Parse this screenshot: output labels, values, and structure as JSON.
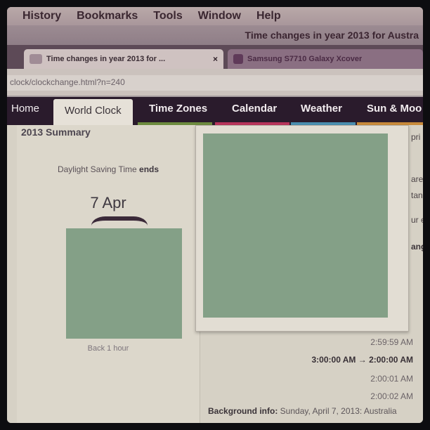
{
  "menu": [
    "History",
    "Bookmarks",
    "Tools",
    "Window",
    "Help"
  ],
  "window_title": "Time changes in year 2013 for Austra",
  "tabs": [
    {
      "label": "Time changes in year 2013 for ...",
      "close": "×"
    },
    {
      "label": "Samsung S7710 Galaxy Xcover"
    }
  ],
  "url": "clock/clockchange.html?n=240",
  "site_nav": [
    "Home",
    "World Clock",
    "Time Zones",
    "Calendar",
    "Weather",
    "Sun & Moo"
  ],
  "summary": {
    "heading": "2013 Summary",
    "dst_prefix": "Daylight Saving Time",
    "dst_bold": "ends",
    "date": "7 Apr",
    "note": "Back 1 hour"
  },
  "right_fragments": [
    "pri",
    "are",
    "tand",
    "ur e",
    "ang"
  ],
  "transition_times": [
    {
      "text": "2:59:59 AM",
      "bold": false
    },
    {
      "text": "3:00:00 AM → 2:00:00 AM",
      "bold": true
    },
    {
      "text": "2:00:01 AM",
      "bold": false
    },
    {
      "text": "2:00:02 AM",
      "bold": false
    }
  ],
  "background": {
    "label": "Background info:",
    "text": "Sunday, April 7, 2013: Australia"
  },
  "colors": {
    "nav_bg": "#2a1b2c",
    "stripe_red": "#b9355c",
    "stripe_blue": "#4a8fb0",
    "stripe_green": "#6d8b3f",
    "stripe_orange": "#c88a3a",
    "redacted": "#84a087"
  }
}
